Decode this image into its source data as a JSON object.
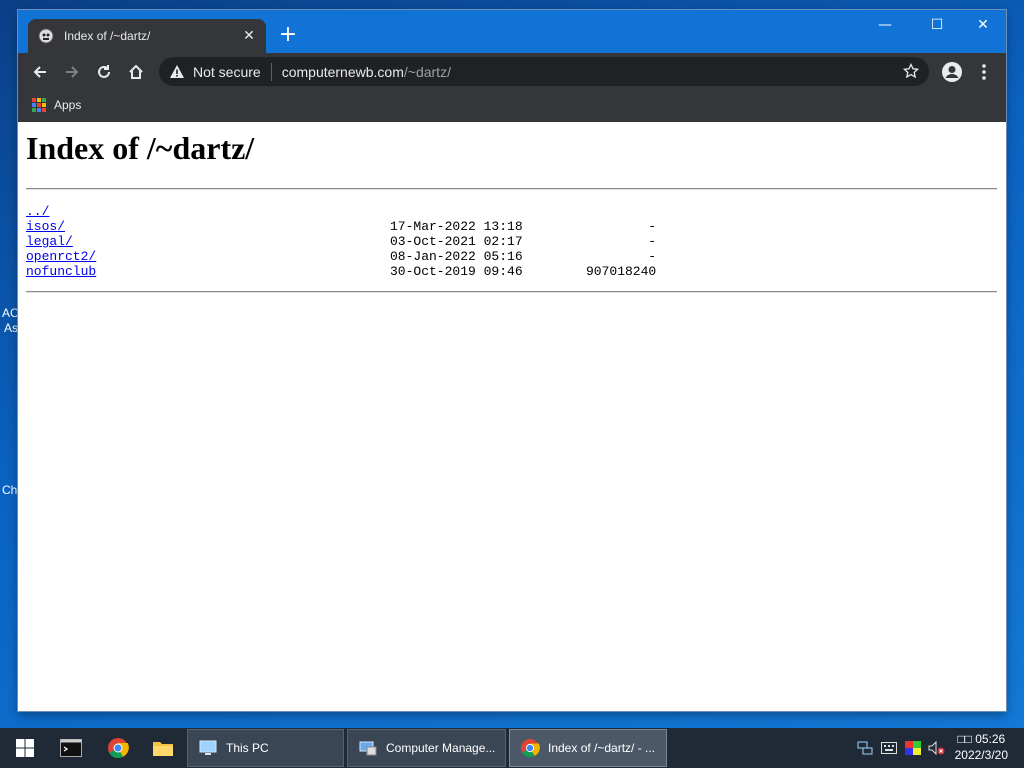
{
  "desktop": {
    "fragments": [
      "AC",
      "As",
      "Ch"
    ]
  },
  "browser": {
    "tab_title": "Index of /~dartz/",
    "tab_close": "✕",
    "new_tab": "+",
    "window_controls": {
      "minimize": "—",
      "maximize": "☐",
      "close": "✕"
    },
    "security_label": "Not secure",
    "url_host": "computernewb.com",
    "url_path": "/~dartz/",
    "bookmarks": {
      "apps_label": "Apps"
    }
  },
  "page": {
    "heading": "Index of /~dartz/",
    "entries": [
      {
        "name": "../",
        "date": "",
        "size": ""
      },
      {
        "name": "isos/",
        "date": "17-Mar-2022 13:18",
        "size": "-"
      },
      {
        "name": "legal/",
        "date": "03-Oct-2021 02:17",
        "size": "-"
      },
      {
        "name": "openrct2/",
        "date": "08-Jan-2022 05:16",
        "size": "-"
      },
      {
        "name": "nofunclub",
        "date": "30-Oct-2019 09:46",
        "size": "907018240"
      }
    ]
  },
  "taskbar": {
    "items": [
      {
        "label": "This PC",
        "icon": "this-pc-icon"
      },
      {
        "label": "Computer Manage...",
        "icon": "computer-management-icon"
      },
      {
        "label": "Index of /~dartz/ - ...",
        "icon": "chrome-icon"
      }
    ],
    "clock_time": "□□ 05:26",
    "clock_date": "2022/3/20"
  },
  "colors": {
    "tab_strip": "#1173d6",
    "toolbar": "#35363a",
    "link": "#0000ee",
    "taskbar": "#1f2a36"
  }
}
